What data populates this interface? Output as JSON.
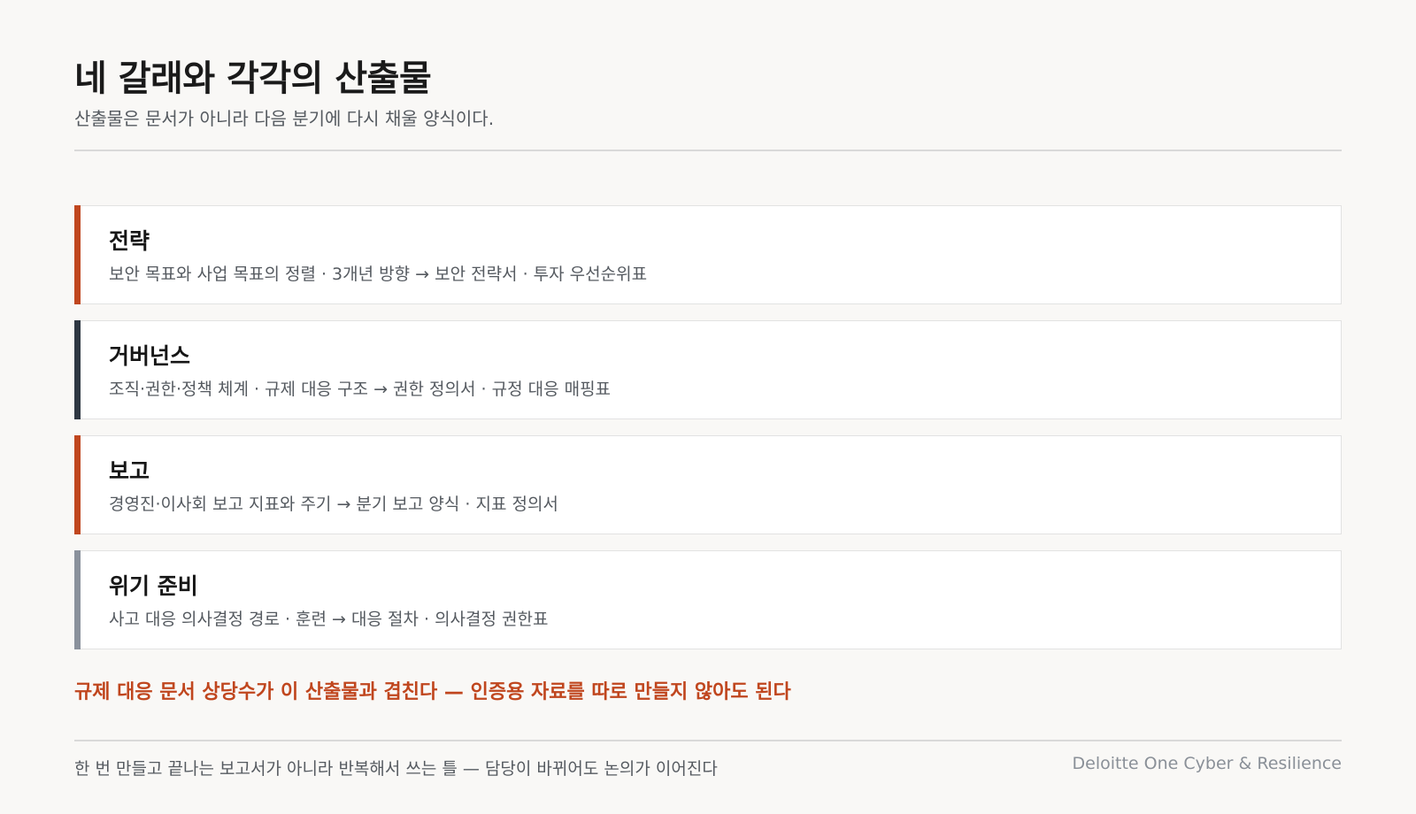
{
  "header": {
    "title": "네 갈래와 각각의 산출물",
    "subtitle": "산출물은 문서가 아니라 다음 분기에 다시 채울 양식이다."
  },
  "cards": [
    {
      "title": "전략",
      "description": "보안 목표와 사업 목표의 정렬 · 3개년 방향 → 보안 전략서 · 투자 우선순위표",
      "accent": "#c0461e"
    },
    {
      "title": "거버넌스",
      "description": "조직·권한·정책 체계 · 규제 대응 구조 → 권한 정의서 · 규정 대응 매핑표",
      "accent": "#2e3742"
    },
    {
      "title": "보고",
      "description": "경영진·이사회 보고 지표와 주기 → 분기 보고 양식 · 지표 정의서",
      "accent": "#c0461e"
    },
    {
      "title": "위기 준비",
      "description": "사고 대응 의사결정 경로 · 훈련 → 대응 절차 · 의사결정 권한표",
      "accent": "#8a919c"
    }
  ],
  "callout": "규제 대응 문서 상당수가 이 산출물과 겹친다 — 인증용 자료를 따로 만들지 않아도 된다",
  "footer": {
    "note": "한 번 만들고 끝나는 보고서가 아니라 반복해서 쓰는 틀 — 담당이 바뀌어도 논의가 이어진다",
    "brand": "Deloitte One Cyber & Resilience"
  },
  "colors": {
    "background": "#f9f8f6",
    "accent_orange": "#c0461e",
    "accent_dark": "#2e3742",
    "accent_gray": "#8a919c"
  }
}
